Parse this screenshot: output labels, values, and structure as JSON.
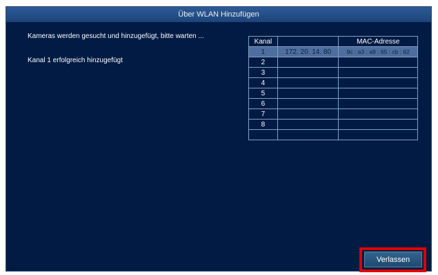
{
  "dialog": {
    "title": "Über WLAN Hinzufügen",
    "status_searching": "Kameras werden gesucht und hinzugefügt, bitte warten ...",
    "status_added": "Kanal 1 erfolgreich hinzugefügt"
  },
  "table": {
    "headers": [
      "Kanal",
      "",
      "MAC-Adresse"
    ],
    "rows": [
      {
        "channel": "1",
        "ip": "172. 20. 14. 80",
        "mac": "9c : a3 : a9 : 65 : cb : 62",
        "selected": true
      },
      {
        "channel": "2",
        "ip": "",
        "mac": ""
      },
      {
        "channel": "3",
        "ip": "",
        "mac": ""
      },
      {
        "channel": "4",
        "ip": "",
        "mac": ""
      },
      {
        "channel": "5",
        "ip": "",
        "mac": ""
      },
      {
        "channel": "6",
        "ip": "",
        "mac": ""
      },
      {
        "channel": "7",
        "ip": "",
        "mac": ""
      },
      {
        "channel": "8",
        "ip": "",
        "mac": ""
      },
      {
        "channel": "",
        "ip": "",
        "mac": ""
      }
    ]
  },
  "buttons": {
    "exit_label": "Verlassen"
  },
  "colors": {
    "background": "#011b44",
    "highlight": "#e00000",
    "selected_row": "#4d6e9e"
  }
}
